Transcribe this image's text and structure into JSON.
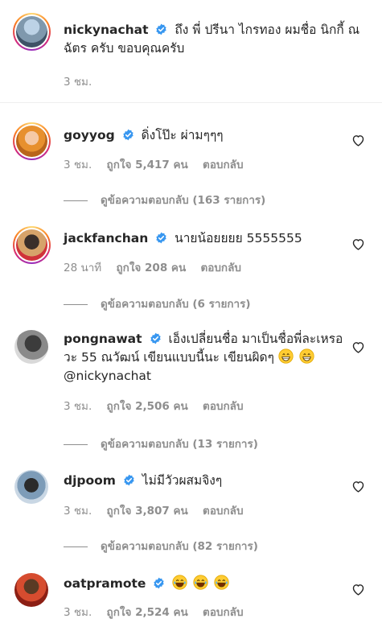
{
  "caption": {
    "username": "nickynachat",
    "text": "ถึง พี่ ปรีนา ไกรทอง ผมชื่อ นิกกี้ ณ ฉัตร ครับ ขอบคุณครับ",
    "time": "3 ชม."
  },
  "comments": [
    {
      "username": "goyyog",
      "text": "ดิ่งโป๊ะ ผ่ามๆๆๆ",
      "time": "3 ชม.",
      "likes": "ถูกใจ 5,417 คน",
      "reply": "ตอบกลับ",
      "view_replies": "ดูข้อความตอบกลับ (163 รายการ)"
    },
    {
      "username": "jackfanchan",
      "text": "นายน้อยยยย 5555555",
      "time": "28 นาที",
      "likes": "ถูกใจ 208 คน",
      "reply": "ตอบกลับ",
      "view_replies": "ดูข้อความตอบกลับ (6 รายการ)"
    },
    {
      "username": "pongnawat",
      "text": "เอ็งเปลี่ยนชื่อ มาเป็นชื่อพี่ละเหรอวะ 55 ณวัฒน์ เขียนแบบนี้นะ เขียนผิดๆ",
      "mention": "@nickynachat",
      "time": "3 ชม.",
      "likes": "ถูกใจ 2,506 คน",
      "reply": "ตอบกลับ",
      "view_replies": "ดูข้อความตอบกลับ (13 รายการ)"
    },
    {
      "username": "djpoom",
      "text": "ไม่มีวัวผสมจิงๆ",
      "time": "3 ชม.",
      "likes": "ถูกใจ 3,807 คน",
      "reply": "ตอบกลับ",
      "view_replies": "ดูข้อความตอบกลับ (82 รายการ)"
    },
    {
      "username": "oatpramote",
      "time": "3 ชม.",
      "likes": "ถูกใจ 2,524 คน",
      "reply": "ตอบกลับ"
    }
  ],
  "icons": {
    "verified": "verified-badge-icon",
    "like": "heart-icon",
    "emoji_grin": "grinning-face-emoji",
    "emoji_laugh": "tears-of-joy-emoji"
  },
  "colors": {
    "verified_blue": "#3897f0",
    "text": "#262626",
    "secondary": "#8e8e8e"
  }
}
